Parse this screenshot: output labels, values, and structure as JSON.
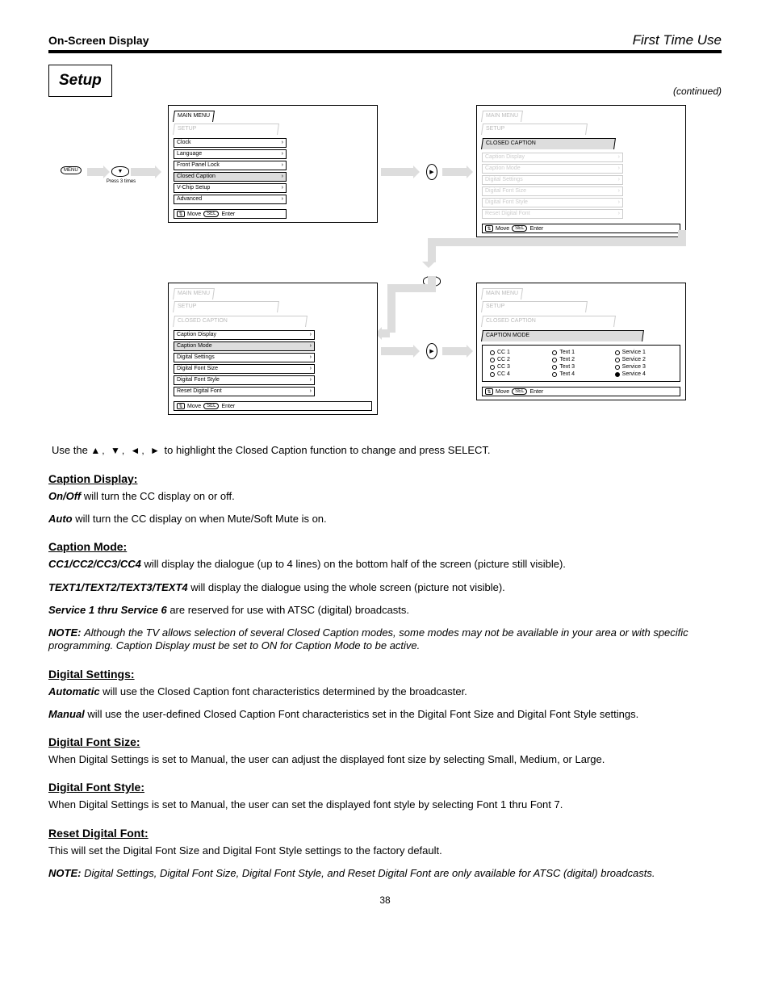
{
  "header": {
    "left": "On-Screen Display",
    "right": "First Time Use"
  },
  "section_box": "Setup",
  "continued": "(continued)",
  "flow": {
    "btn_menu": "MENU",
    "hint_press3": "Press 3 times"
  },
  "panel1": {
    "tab_main": "MAIN MENU",
    "tab_sub": "SETUP",
    "rows": [
      "Clock",
      "Language",
      "Front Panel Lock",
      "Closed Caption",
      "V-Chip Setup",
      "Advanced"
    ],
    "footer_move": "Move",
    "footer_sel": "SEL",
    "footer_enter": "Enter"
  },
  "panel2": {
    "tab_main": "MAIN MENU",
    "tab_sub": "SETUP",
    "tab_third": "CLOSED CAPTION",
    "rows": [
      "Caption Display",
      "Caption Mode",
      "Digital Settings",
      "Digital Font Size",
      "Digital Font Style",
      "Reset Digital Font"
    ],
    "footer_move": "Move",
    "footer_sel": "SEL",
    "footer_enter": "Enter"
  },
  "panel3": {
    "tab_main": "MAIN MENU",
    "tab_sub": "SETUP",
    "tab_third": "CLOSED CAPTION",
    "rows": [
      "Caption Display",
      "Caption Mode",
      "Digital Settings",
      "Digital Font Size",
      "Digital Font Style",
      "Reset Digital Font"
    ],
    "footer_move": "Move",
    "footer_sel": "SEL",
    "footer_enter": "Enter"
  },
  "panel4": {
    "tab_main": "MAIN MENU",
    "tab_sub": "SETUP",
    "tab_third": "CLOSED CAPTION",
    "tab_fourth": "CAPTION MODE",
    "options": [
      "CC 1",
      "CC 2",
      "CC 3",
      "CC 4",
      "Text 1",
      "Text 2",
      "Text 3",
      "Text 4",
      "Service 1",
      "Service 2",
      "Service 3",
      "Service 4"
    ],
    "selected_index": 11,
    "footer_move": "Move",
    "footer_sel": "SEL",
    "footer_enter": "Enter"
  },
  "body": {
    "line1_a": "Use the ",
    "line1_arrows": "▲, ▼, ◄, ►",
    "line1_b": " to highlight the Closed Caption function to change and press SELECT.",
    "sub1_title": "Caption Display:",
    "sub1_on": "On/Off",
    "sub1_on_text": " will turn the CC display on or off.",
    "sub1_auto": "Auto",
    "sub1_auto_text": " will turn the CC display on when Mute/Soft Mute is on.",
    "sub2_title": "Caption Mode:",
    "sub2_cc1": "CC1/CC2/CC3/CC4",
    "sub2_cc1_text": " will display the dialogue (up to 4 lines) on the bottom half of the screen (picture still visible).",
    "sub2_text": "TEXT1/TEXT2/TEXT3/TEXT4",
    "sub2_text_text": " will display the dialogue using the whole screen (picture not visible).",
    "sub2_svc": "Service 1 thru Service 6",
    "sub2_svc_text": " are reserved for use with ATSC (digital) broadcasts.",
    "note_label": "NOTE: ",
    "note_text": "Although the TV allows selection of several Closed Caption modes, some modes may not be available in your area or with specific programming. Caption Display must be set to ON for Caption Mode to be active.",
    "sub3_title": "Digital Settings:",
    "sub3_auto": "Automatic",
    "sub3_auto_text": " will use the Closed Caption font characteristics determined by the broadcaster.",
    "sub3_man": "Manual",
    "sub3_man_text": " will use the user-defined Closed Caption Font characteristics set in the Digital Font Size and Digital Font Style settings.",
    "sub4_title": "Digital Font Size:",
    "sub4_text": "When Digital Settings is set to Manual, the user can adjust the displayed font size by selecting Small, Medium, or Large.",
    "sub5_title": "Digital Font Style:",
    "sub5_text": "When Digital Settings is set to Manual, the user can set the displayed font style by selecting Font 1 thru Font 7.",
    "sub6_title": "Reset Digital Font:",
    "sub6_text": "This will set the Digital Font Size and Digital Font Style settings to the factory default.",
    "note2_label": "NOTE: ",
    "note2_text": "Digital Settings, Digital Font Size, Digital Font Style, and Reset Digital Font are only available for ATSC (digital) broadcasts."
  },
  "page_number": "38"
}
